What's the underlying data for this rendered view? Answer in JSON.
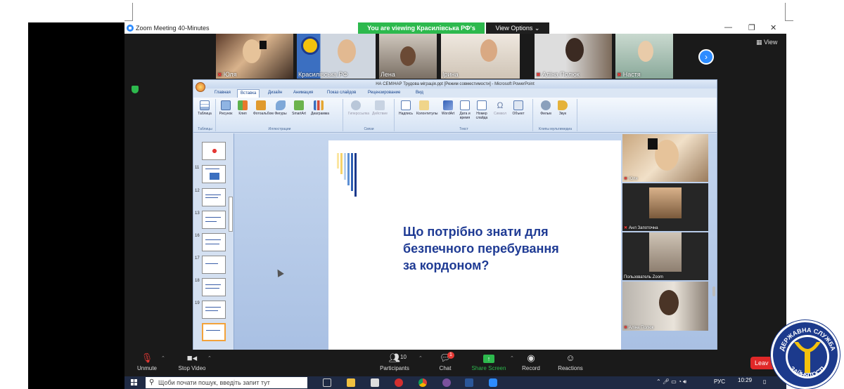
{
  "window": {
    "title": "Zoom Meeting 40-Minutes",
    "viewing_banner": "You are viewing Красилівська РФ's screen",
    "view_options": "View Options",
    "view_label": "View"
  },
  "participants_strip": [
    {
      "name": "Юля",
      "muted": true
    },
    {
      "name": "Красилівська РФ",
      "muted": false
    },
    {
      "name": "Лена",
      "muted": false
    },
    {
      "name": "Ірина",
      "muted": false
    },
    {
      "name": "Аліна Полюк",
      "muted": true
    },
    {
      "name": "Настя",
      "muted": true
    }
  ],
  "powerpoint": {
    "title": "НА СЕМІНАР Трудова міграція.ppt [Режим совместимости] - Microsoft PowerPoint",
    "tabs": [
      "Главная",
      "Вставка",
      "Дизайн",
      "Анимация",
      "Показ слайдов",
      "Рецензирование",
      "Вид"
    ],
    "active_tab": "Вставка",
    "ribbon_groups": [
      {
        "label": "Таблицы",
        "buttons": [
          "Таблица"
        ]
      },
      {
        "label": "Иллюстрации",
        "buttons": [
          "Рисунок",
          "Клип",
          "Фотоальбом",
          "Фигуры",
          "SmartArt",
          "Диаграмма"
        ]
      },
      {
        "label": "Связи",
        "buttons": [
          "Гиперссылка",
          "Действие"
        ]
      },
      {
        "label": "Текст",
        "buttons": [
          "Надпись",
          "Колонтитулы",
          "WordArt",
          "Дата и время",
          "Номер слайда",
          "Символ",
          "Объект"
        ]
      },
      {
        "label": "Клипы мультимедиа",
        "buttons": [
          "Фильм",
          "Звук"
        ]
      }
    ],
    "slide_numbers": [
      "",
      "",
      "",
      "",
      "",
      "",
      "",
      "",
      ""
    ],
    "slide_number_labels": [
      "",
      "11",
      "12",
      "13",
      "16",
      "17",
      "18",
      "19",
      "",
      "21"
    ],
    "slide_title_lines": [
      "Що потрібно знати для",
      "безпечного перебування",
      "за кордоном?"
    ]
  },
  "gallery": [
    {
      "name": "Юля",
      "muted": true
    },
    {
      "name": "Анл Запоточна",
      "muted": true
    },
    {
      "name": "Пользователь Zoom",
      "muted": false
    },
    {
      "name": "Аліна Полюк",
      "muted": true
    }
  ],
  "toolbar": {
    "unmute": "Unmute",
    "stop_video": "Stop Video",
    "participants": "Participants",
    "participants_count": "10",
    "chat": "Chat",
    "chat_badge": "1",
    "share_screen": "Share Screen",
    "record": "Record",
    "reactions": "Reactions",
    "leave": "Leav"
  },
  "taskbar": {
    "search_placeholder": "Щоби почати пошук, введіть запит тут",
    "language": "РУС",
    "time": "10:29"
  },
  "seal": {
    "text_top": "ДЕРЖАВНА СЛУЖБА",
    "text_bottom": "ЗАЙНЯТОСТІ"
  },
  "colors": {
    "zoom_blue": "#2d8cff",
    "zoom_green": "#2db94d",
    "leave_red": "#e02828",
    "slide_title": "#1f3b94",
    "seal_blue": "#1c3a8c",
    "seal_yellow": "#f4c20d"
  }
}
